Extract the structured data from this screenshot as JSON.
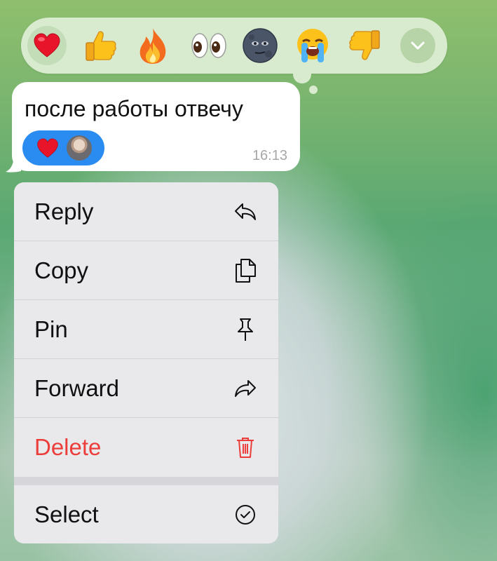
{
  "reactions": {
    "items": [
      {
        "name": "heart",
        "selected": true
      },
      {
        "name": "thumbs-up",
        "selected": false
      },
      {
        "name": "fire",
        "selected": false
      },
      {
        "name": "eyes",
        "selected": false
      },
      {
        "name": "new-moon-face",
        "selected": false
      },
      {
        "name": "loudly-crying-face",
        "selected": false
      },
      {
        "name": "thumbs-down",
        "selected": false
      }
    ],
    "expand_icon": "chevron-down-icon"
  },
  "message": {
    "text": "после работы отвечу",
    "time": "16:13",
    "reaction_icon": "heart"
  },
  "menu": {
    "items": [
      {
        "label": "Reply",
        "icon": "reply-icon"
      },
      {
        "label": "Copy",
        "icon": "copy-icon"
      },
      {
        "label": "Pin",
        "icon": "pin-icon"
      },
      {
        "label": "Forward",
        "icon": "forward-icon"
      },
      {
        "label": "Delete",
        "icon": "trash-icon",
        "destructive": true
      },
      {
        "label": "Select",
        "icon": "checkmark-circle-icon"
      }
    ]
  },
  "colors": {
    "accent": "#2a8cf0",
    "destructive": "#ec3d3a",
    "reaction_bar": "#d9ebcf"
  }
}
